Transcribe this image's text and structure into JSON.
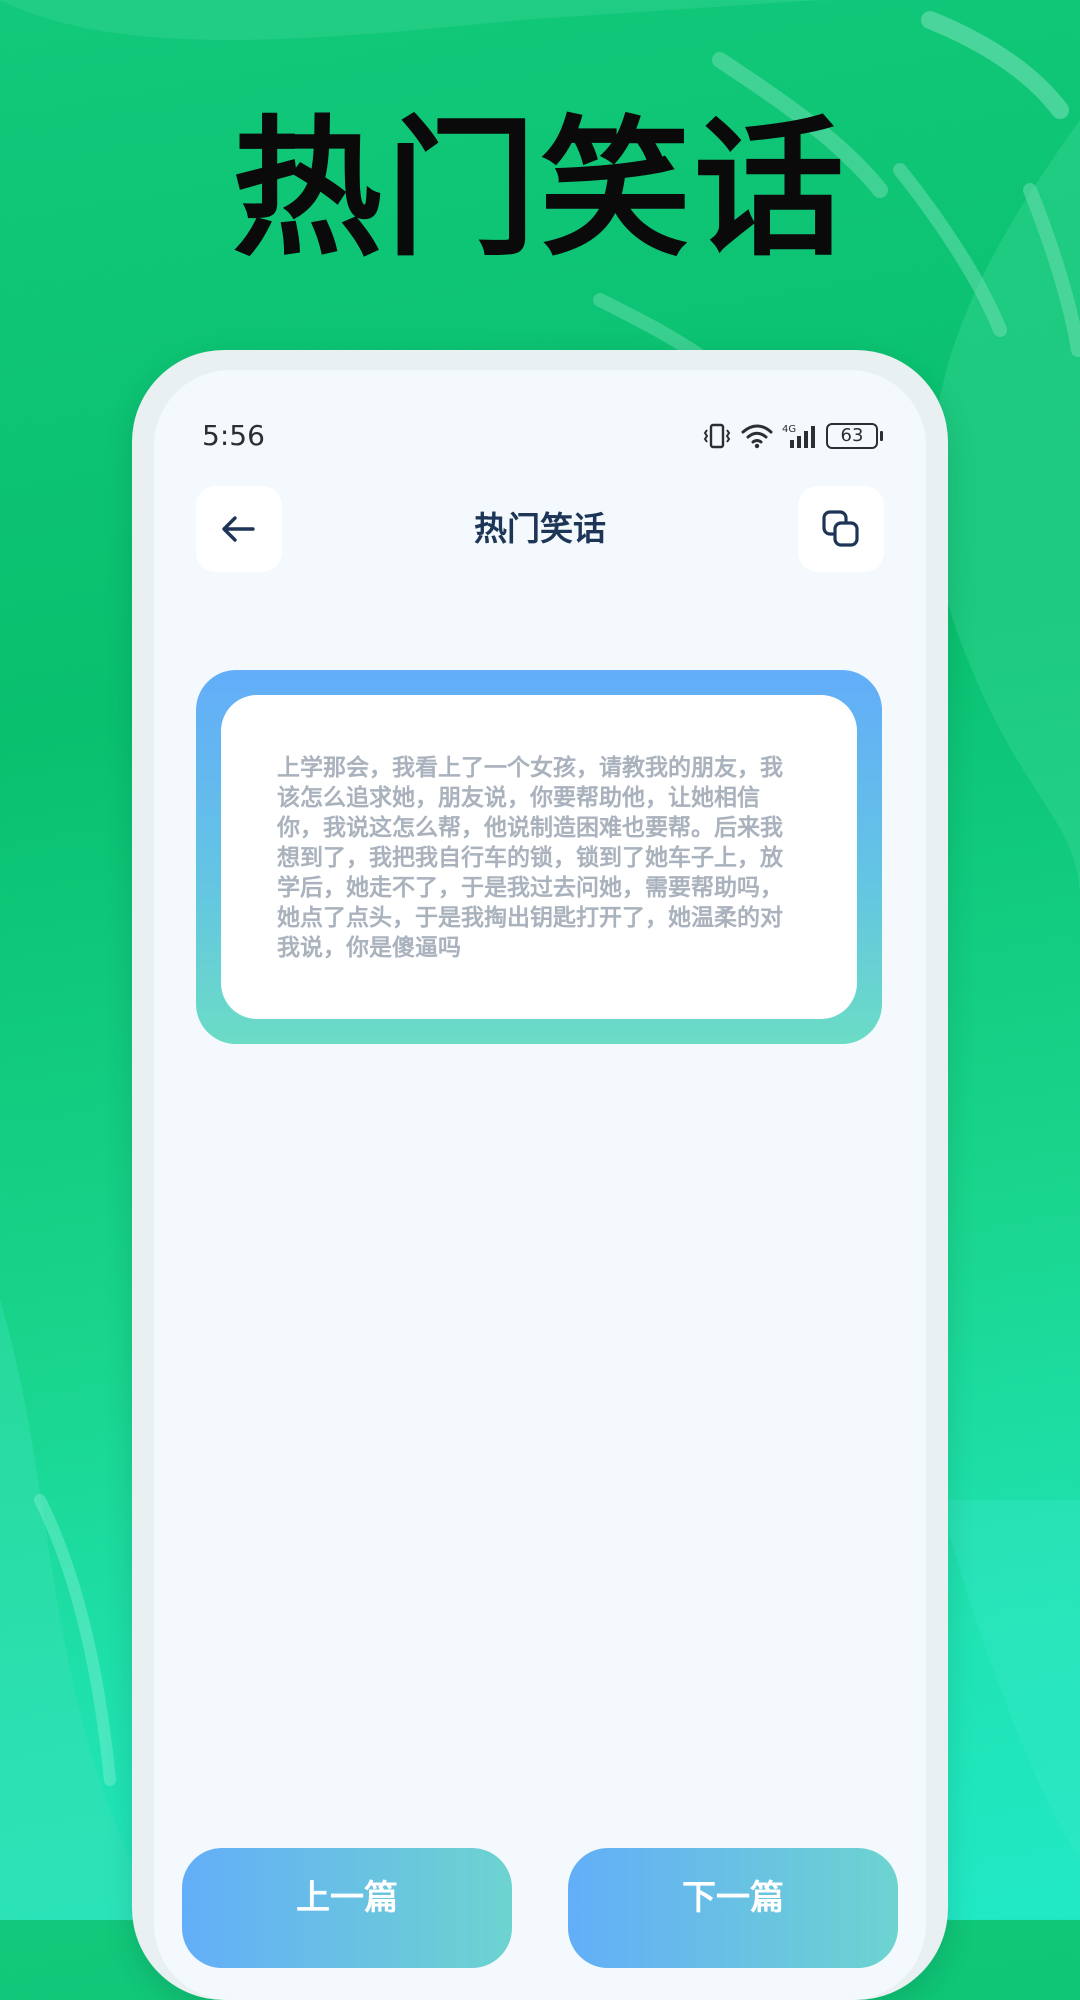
{
  "hero": {
    "title": "热门笑话"
  },
  "status_bar": {
    "time": "5:56",
    "network": "4G",
    "battery": "63"
  },
  "nav": {
    "back_icon": "arrow-left-icon",
    "title": "热门笑话",
    "copy_icon": "copy-icon"
  },
  "joke": {
    "text": "上学那会，我看上了一个女孩，请教我的朋友，我该怎么追求她，朋友说，你要帮助他，让她相信你，我说这怎么帮，他说制造困难也要帮。后来我想到了，我把我自行车的锁，锁到了她车子上，放学后，她走不了，于是我过去问她，需要帮助吗，她点了点头，于是我掏出钥匙打开了，她温柔的对我说，你是傻逼吗"
  },
  "buttons": {
    "prev_label": "上一篇",
    "next_label": "下一篇"
  },
  "colors": {
    "background_top": "#09c06f",
    "background_bottom": "#21e9c6",
    "card_gradient_top": "#63adf9",
    "card_gradient_bottom": "#6bdcc5",
    "title_dark": "#1d3557",
    "joke_text": "#a9b2bd"
  }
}
